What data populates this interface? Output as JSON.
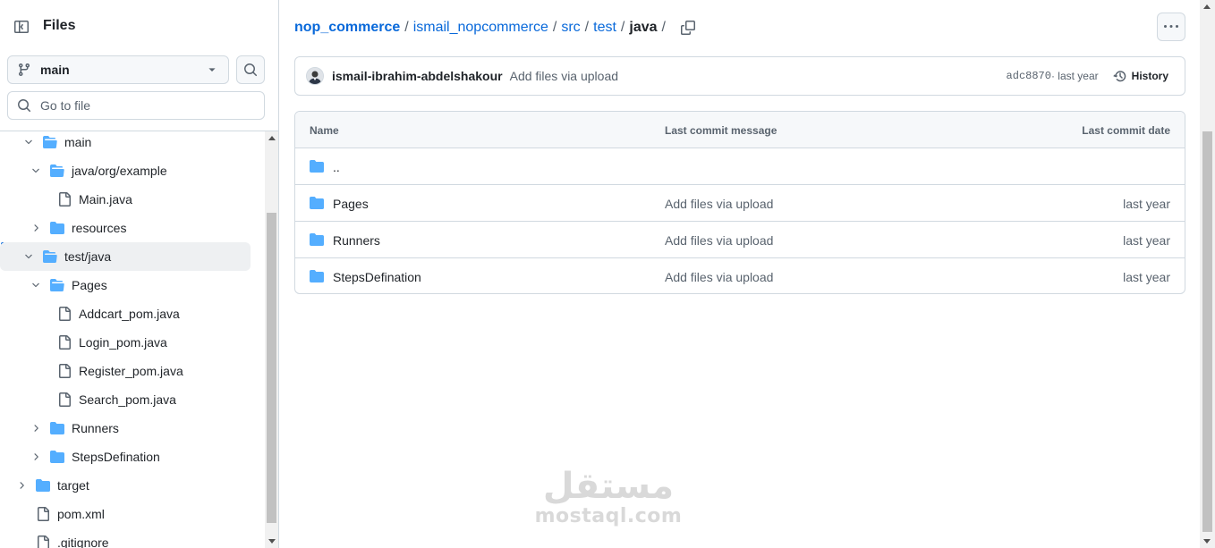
{
  "sidebar": {
    "title": "Files",
    "branch": "main",
    "goto_placeholder": "Go to file",
    "tree": [
      {
        "label": "main",
        "type": "folder",
        "depth": 1,
        "expanded": true
      },
      {
        "label": "java/org/example",
        "type": "folder",
        "depth": 2,
        "expanded": true
      },
      {
        "label": "Main.java",
        "type": "file",
        "depth": 3
      },
      {
        "label": "resources",
        "type": "folder",
        "depth": 2,
        "expanded": false
      },
      {
        "label": "test/java",
        "type": "folder",
        "depth": 1,
        "expanded": true,
        "selected": true
      },
      {
        "label": "Pages",
        "type": "folder",
        "depth": 2,
        "expanded": true
      },
      {
        "label": "Addcart_pom.java",
        "type": "file",
        "depth": 3
      },
      {
        "label": "Login_pom.java",
        "type": "file",
        "depth": 3
      },
      {
        "label": "Register_pom.java",
        "type": "file",
        "depth": 3
      },
      {
        "label": "Search_pom.java",
        "type": "file",
        "depth": 3
      },
      {
        "label": "Runners",
        "type": "folder",
        "depth": 2,
        "expanded": false
      },
      {
        "label": "StepsDefination",
        "type": "folder",
        "depth": 2,
        "expanded": false
      },
      {
        "label": "target",
        "type": "folder",
        "depth": 0,
        "expanded": false
      },
      {
        "label": "pom.xml",
        "type": "file",
        "depth": 0
      },
      {
        "label": ".gitignore",
        "type": "file",
        "depth": 0
      }
    ]
  },
  "breadcrumb": {
    "repo": "nop_commerce",
    "parts": [
      "ismail_nopcommerce",
      "src",
      "test"
    ],
    "current": "java",
    "sep": "/"
  },
  "commit": {
    "author": "ismail-ibrahim-abdelshakour",
    "message": "Add files via upload",
    "sha": "adc8870",
    "time": " · last year",
    "history_label": "History"
  },
  "table": {
    "headers": {
      "name": "Name",
      "message": "Last commit message",
      "date": "Last commit date"
    },
    "parent_label": "..",
    "rows": [
      {
        "name": "Pages",
        "message": "Add files via upload",
        "date": "last year"
      },
      {
        "name": "Runners",
        "message": "Add files via upload",
        "date": "last year"
      },
      {
        "name": "StepsDefination",
        "message": "Add files via upload",
        "date": "last year"
      }
    ]
  },
  "watermark": {
    "arabic": "مستقل",
    "latin": "mostaql.com"
  },
  "colors": {
    "accent": "#0969da",
    "folder": "#54aeff",
    "muted": "#59636e",
    "border": "#d1d9e0"
  }
}
